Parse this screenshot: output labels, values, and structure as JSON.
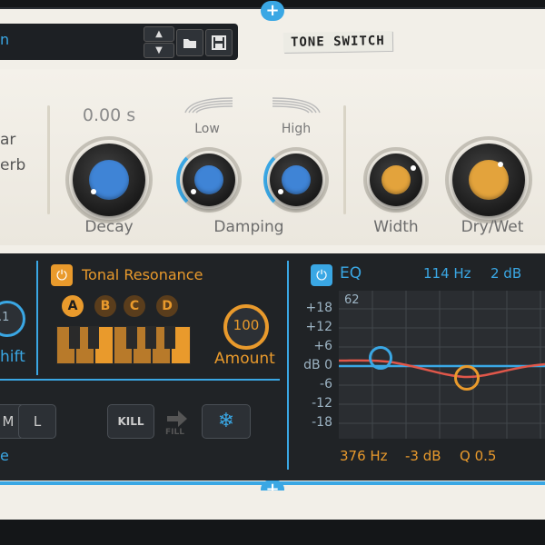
{
  "header": {
    "preset_name": "n",
    "tone_switch": "TONE SWITCH",
    "add_symbol": "+"
  },
  "reverb": {
    "title_line1": "ar",
    "title_line2": "erb",
    "decay_value": "0.00 s",
    "decay_label": "Decay",
    "damping_low": "Low",
    "damping_high": "High",
    "damping_label": "Damping",
    "width_label": "Width",
    "drywet_label": "Dry/Wet"
  },
  "shift": {
    "value": ".1",
    "label": "hift"
  },
  "tonal": {
    "title": "Tonal Resonance",
    "modes": [
      "A",
      "B",
      "C",
      "D"
    ],
    "amount_value": "100",
    "amount_label": "Amount"
  },
  "bottom_left": {
    "btn_m": "M",
    "btn_l": "L",
    "label_e": "e",
    "kill": "KILL",
    "fill": "FILL",
    "freeze_icon": "❄"
  },
  "eq": {
    "title": "EQ",
    "freq_top": "114 Hz",
    "gain_top": "2 dB",
    "corner_label": "62",
    "db_ticks": [
      "+18",
      "+12",
      "+6",
      "dB 0",
      "-6",
      "-12",
      "-18"
    ],
    "freq_bottom": "376 Hz",
    "gain_bottom": "-3 dB",
    "q_bottom": "Q 0.5"
  },
  "colors": {
    "accent_blue": "#3aa7e4",
    "accent_orange": "#e99a2c",
    "knob_blue": "#3f84d6",
    "knob_orange": "#e3a33c"
  }
}
